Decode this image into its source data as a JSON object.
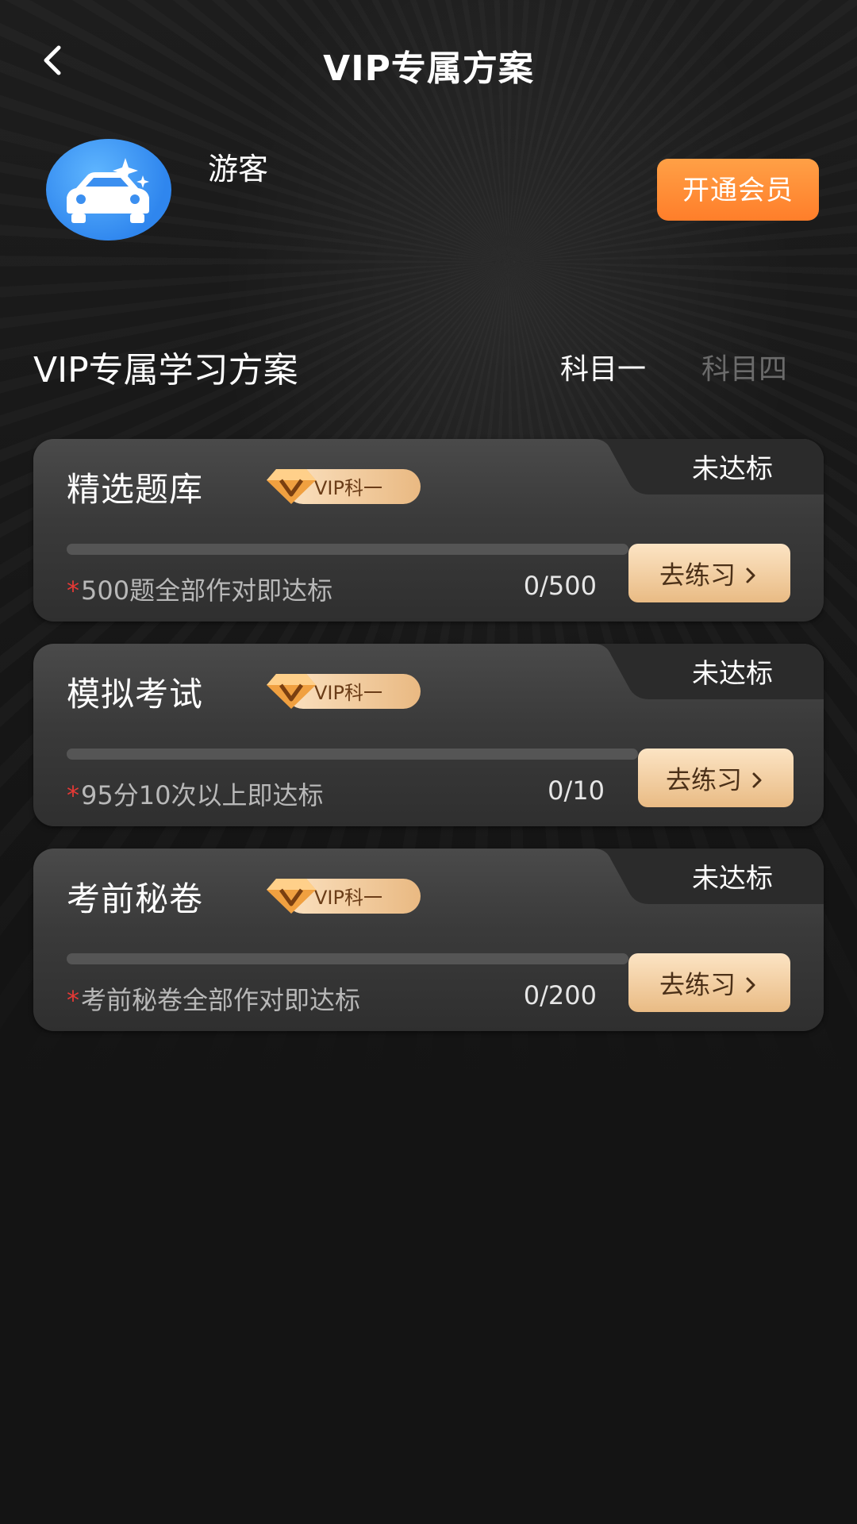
{
  "header": {
    "title": "VIP专属方案",
    "back_icon": "chevron-left-icon"
  },
  "profile": {
    "avatar_icon": "car-sparkle-icon",
    "username": "游客",
    "open_vip_label": "开通会员"
  },
  "section": {
    "title": "VIP专属学习方案",
    "tabs": [
      {
        "label": "科目一",
        "active": true
      },
      {
        "label": "科目四",
        "active": false
      }
    ]
  },
  "colors": {
    "accent_orange": "#ff8a33",
    "gold": "#e9b982",
    "asterisk_red": "#e53935"
  },
  "cards": [
    {
      "title": "精选题库",
      "badge": "VIP科一",
      "status": "未达标",
      "asterisk": "*",
      "description": "500题全部作对即达标",
      "count": "0/500",
      "progress": 0,
      "button_label": "去练习"
    },
    {
      "title": "模拟考试",
      "badge": "VIP科一",
      "status": "未达标",
      "asterisk": "*",
      "description": "95分10次以上即达标",
      "count": "0/10",
      "progress": 0,
      "button_label": "去练习"
    },
    {
      "title": "考前秘卷",
      "badge": "VIP科一",
      "status": "未达标",
      "asterisk": "*",
      "description": "考前秘卷全部作对即达标",
      "count": "0/200",
      "progress": 0,
      "button_label": "去练习"
    }
  ]
}
